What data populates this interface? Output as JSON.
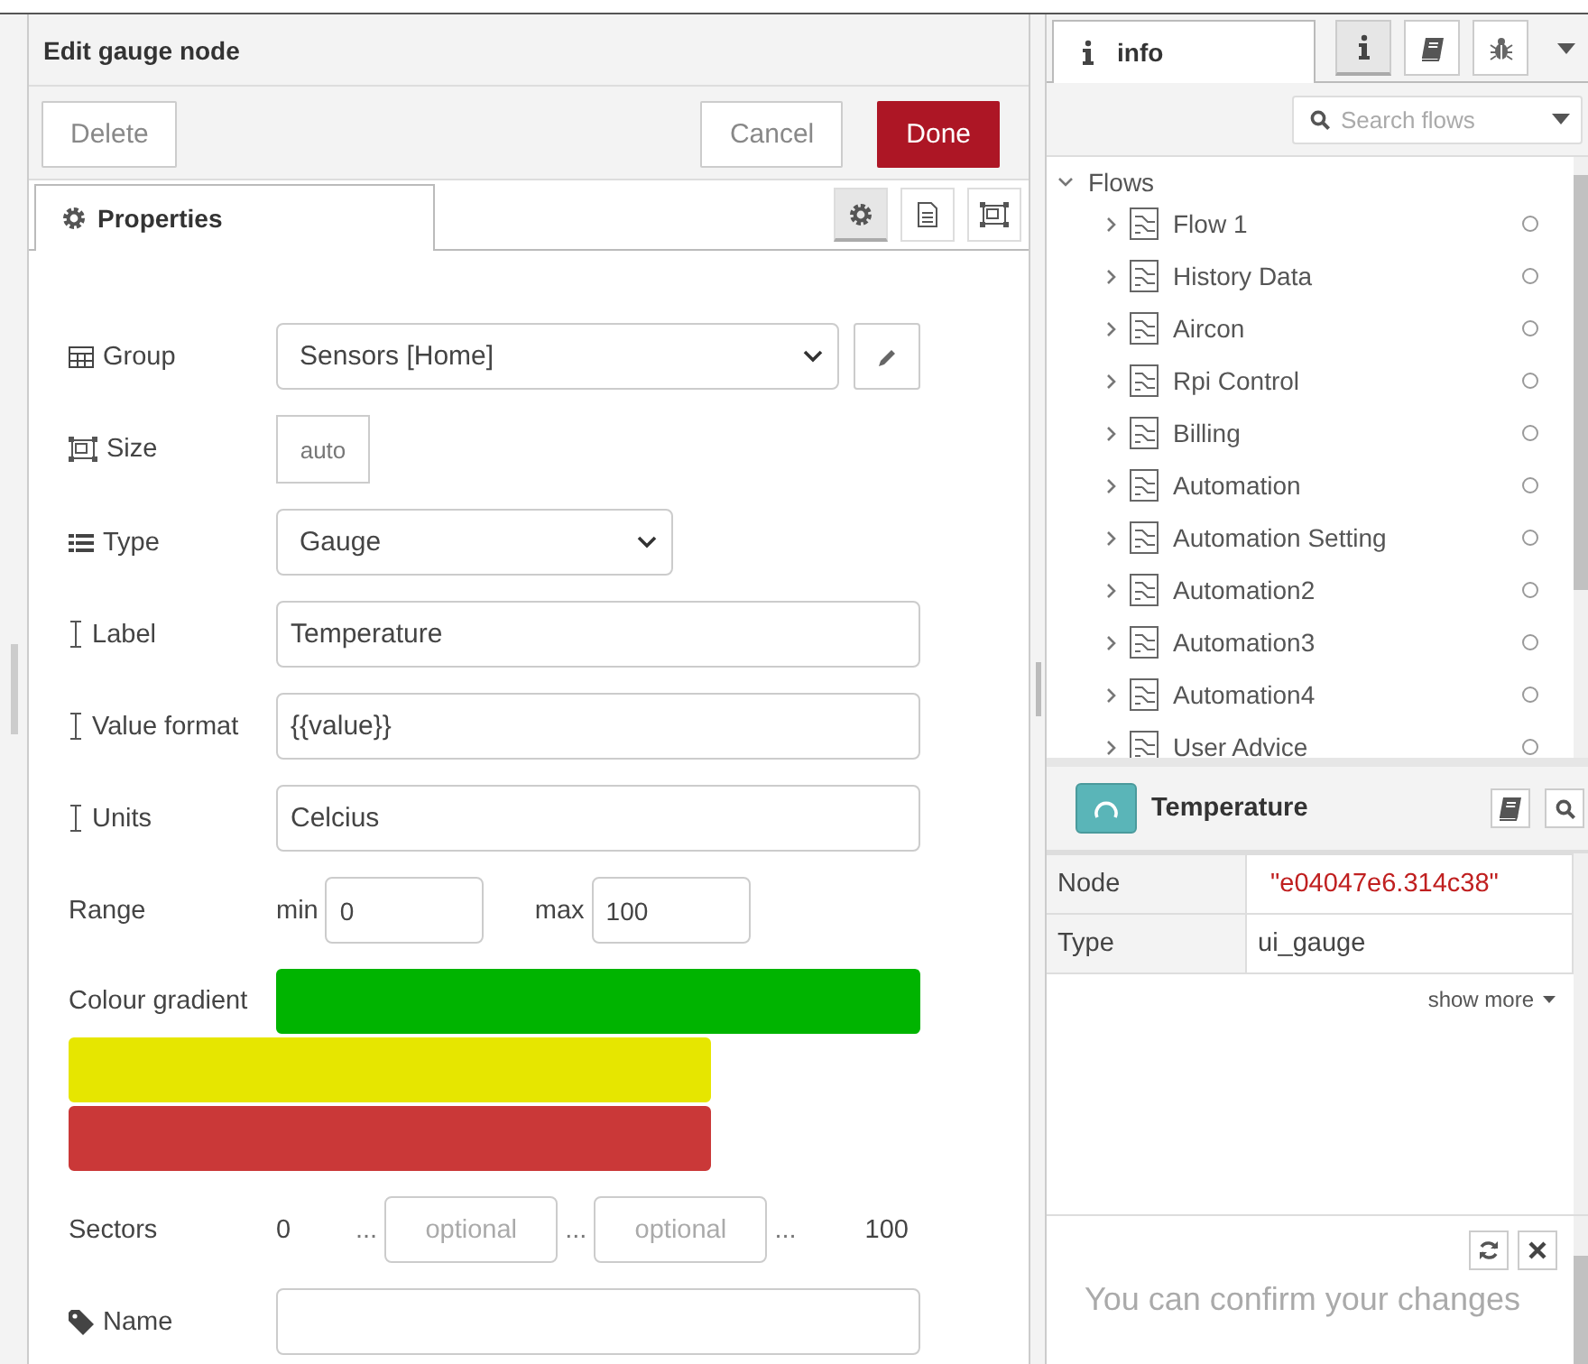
{
  "editor": {
    "title": "Edit gauge node",
    "buttons": [
      {
        "label": "Delete",
        "kind": "plain"
      },
      {
        "label": "Cancel",
        "kind": "plain"
      },
      {
        "label": "Done",
        "kind": "primary"
      }
    ],
    "tabs": [
      {
        "label": "Properties",
        "selected": true
      }
    ],
    "tab_tools": [
      {
        "selected": true
      },
      {
        "selected": false
      },
      {
        "selected": false
      }
    ],
    "fields": [
      {
        "kind": "select",
        "label": "Group",
        "value": "Sensors [Home]",
        "edit_button": true
      },
      {
        "kind": "size",
        "label": "Size",
        "value": "auto"
      },
      {
        "kind": "select",
        "label": "Type",
        "value": "Gauge"
      },
      {
        "kind": "text",
        "label": "Label",
        "value": "Temperature"
      },
      {
        "kind": "text",
        "label": "Value format",
        "value": "{{value}}"
      },
      {
        "kind": "text",
        "label": "Units",
        "value": "Celcius"
      },
      {
        "kind": "range",
        "label": "Range",
        "min_label": "min",
        "min": "0",
        "max_label": "max",
        "max": "100"
      },
      {
        "kind": "gradient",
        "label": "Colour gradient",
        "bands": [
          {
            "color": "#00b400"
          },
          {
            "color": "#e6e600"
          },
          {
            "color": "#ca3838"
          }
        ]
      },
      {
        "kind": "sectors",
        "label": "Sectors",
        "start": "0",
        "separators": [
          "...",
          "...",
          "..."
        ],
        "placeholders": [
          "optional",
          "optional"
        ],
        "end": "100"
      },
      {
        "kind": "text",
        "label": "Name"
      }
    ]
  },
  "sidebar": {
    "tabs": [
      {
        "label": "info",
        "selected": true
      }
    ],
    "tools": [
      {
        "selected": true
      },
      {
        "selected": false
      },
      {
        "selected": false
      }
    ],
    "search": {
      "placeholder": "Search flows"
    },
    "tree": {
      "label": "Flows",
      "expanded": true,
      "children": [
        {
          "label": "Flow 1",
          "expanded": false
        },
        {
          "label": "History Data",
          "expanded": false
        },
        {
          "label": "Aircon",
          "expanded": false
        },
        {
          "label": "Rpi Control",
          "expanded": false
        },
        {
          "label": "Billing",
          "expanded": false
        },
        {
          "label": "Automation",
          "expanded": false
        },
        {
          "label": "Automation Setting",
          "expanded": false
        },
        {
          "label": "Automation2",
          "expanded": false
        },
        {
          "label": "Automation3",
          "expanded": false
        },
        {
          "label": "Automation4",
          "expanded": false
        },
        {
          "label": "User Advice",
          "expanded": false
        }
      ]
    },
    "node": {
      "title": "Temperature",
      "rows": [
        {
          "key": "Node",
          "value": "\"e04047e6.314c38\"",
          "kind": "string"
        },
        {
          "key": "Type",
          "value": "ui_gauge",
          "kind": "plain"
        }
      ],
      "show_more": "show more"
    },
    "tip": "You can confirm your changes"
  }
}
